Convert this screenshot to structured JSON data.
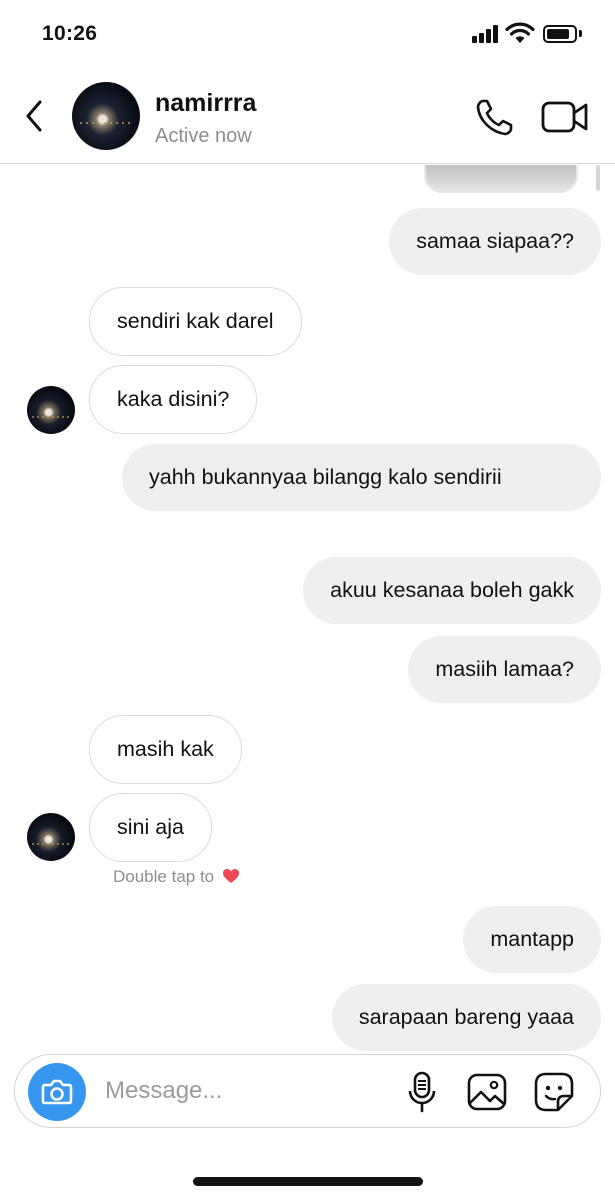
{
  "status_bar": {
    "time": "10:26",
    "battery_level": 0.85,
    "icons": [
      "cellular-signal-icon",
      "wifi-icon",
      "battery-icon"
    ]
  },
  "header": {
    "username": "namirrra",
    "status": "Active now",
    "icons": [
      "back-chevron-icon",
      "phone-icon",
      "video-camera-icon"
    ]
  },
  "messages": [
    {
      "text": "samaa siapaa??",
      "direction": "outgoing"
    },
    {
      "text": "sendiri kak darel",
      "direction": "incoming"
    },
    {
      "text": "kaka disini?",
      "direction": "incoming"
    },
    {
      "text": "yahh bukannyaa bilangg kalo sendirii",
      "direction": "outgoing"
    },
    {
      "text": "akuu kesanaa boleh gakk",
      "direction": "outgoing"
    },
    {
      "text": "masiih lamaa?",
      "direction": "outgoing"
    },
    {
      "text": "masih kak",
      "direction": "incoming"
    },
    {
      "text": "sini aja",
      "direction": "incoming"
    },
    {
      "text": "mantapp",
      "direction": "outgoing"
    },
    {
      "text": "sarapaan bareng yaaa",
      "direction": "outgoing"
    }
  ],
  "reaction_hint": {
    "text": "Double tap to",
    "icon": "red-heart-icon",
    "icon_color": "#ed4956"
  },
  "composer": {
    "placeholder": "Message...",
    "camera_color": "#3797f0",
    "icons": [
      "camera-icon",
      "microphone-icon",
      "gallery-icon",
      "sticker-icon"
    ]
  }
}
